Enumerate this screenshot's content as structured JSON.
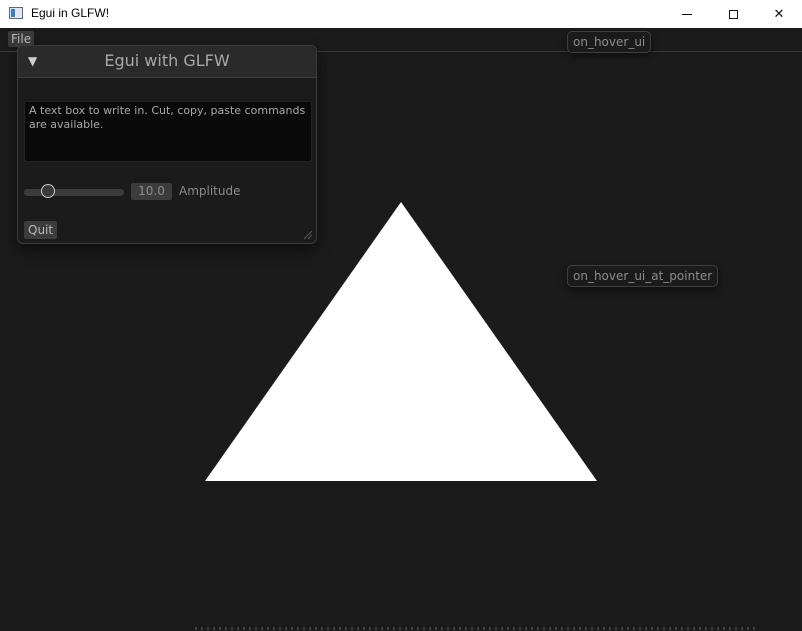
{
  "window": {
    "title": "Egui in GLFW!",
    "controls": {
      "minimize": "minimize-icon",
      "maximize": "maximize-icon",
      "close": "close-icon",
      "close_glyph": "✕"
    }
  },
  "menubar": {
    "items": [
      {
        "label": "File"
      }
    ]
  },
  "egui_window": {
    "title": "Egui with GLFW",
    "collapse_glyph": "▼",
    "textbox": {
      "value": "A text box to write in. Cut, copy, paste commands are available."
    },
    "slider": {
      "value": "10.0",
      "label": "Amplitude",
      "level_fraction": 0.2
    },
    "quit_label": "Quit"
  },
  "tooltips": {
    "hover_ui": "on_hover_ui",
    "hover_ui_at_pointer": "on_hover_ui_at_pointer"
  },
  "scene": {
    "triangle_color": "#ffffff",
    "background_color": "#1b1b1b"
  }
}
